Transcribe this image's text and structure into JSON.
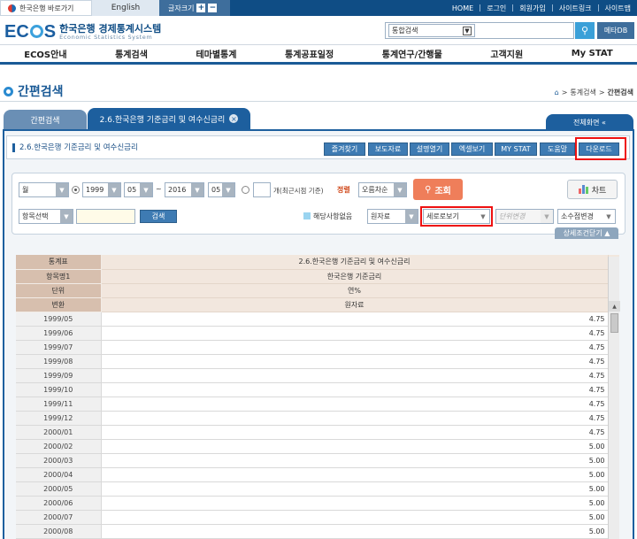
{
  "topbar": {
    "home_link": "한국은행 바로가기",
    "english": "English",
    "font_size": "글자크기",
    "font_plus": "+",
    "font_minus": "−",
    "links": [
      "HOME",
      "로그인",
      "회원가입",
      "사이트링크",
      "사이트맵"
    ]
  },
  "header": {
    "logo": "ECOS",
    "title": "한국은행 경제통계시스템",
    "subtitle": "Economic Statistics System",
    "search_scope": "통합검색",
    "meta_db": "메타DB"
  },
  "nav": [
    "ECOS안내",
    "통계검색",
    "테마별통계",
    "통계공표일정",
    "통계연구/간행물",
    "고객지원",
    "My STAT"
  ],
  "page": {
    "title": "간편검색",
    "breadcrumb": [
      "통계검색",
      "간편검색"
    ]
  },
  "tabs": {
    "tab1": "간편검색",
    "tab2": "2.6.한국은행 기준금리 및 여수신금리",
    "full_screen": "전체화면 «"
  },
  "toolbar": {
    "stat_name": "2.6.한국은행 기준금리 및 여수신금리",
    "buttons": [
      "즐겨찾기",
      "보도자료",
      "설명열기",
      "엑셀보기",
      "MY STAT",
      "도움말",
      "다운로드"
    ]
  },
  "options": {
    "period": "월",
    "start_year": "1999",
    "start_month": "05",
    "tilde": "~",
    "end_year": "2016",
    "end_month": "05",
    "recent_label": "개(최근시점 기준)",
    "sort_label": "정렬",
    "sort_value": "오름차순",
    "search_btn": "조회",
    "chart_btn": "차트",
    "item_select": "항목선택",
    "item_search_btn": "검색",
    "not_applicable": "해당사항없음",
    "raw": "원자료",
    "vertical_view": "세로로보기",
    "unit_change": "단위변경",
    "decimal_change": "소수점변경",
    "detail_toggle": "상세조건닫기 ▲"
  },
  "table": {
    "header": [
      {
        "label": "통계표",
        "value": "2.6.한국은행 기준금리 및 여수신금리"
      },
      {
        "label": "항목명1",
        "value": "한국은행 기준금리"
      },
      {
        "label": "단위",
        "value": "연%"
      },
      {
        "label": "변환",
        "value": "원자료"
      }
    ],
    "rows": [
      {
        "date": "1999/05",
        "value": "4.75"
      },
      {
        "date": "1999/06",
        "value": "4.75"
      },
      {
        "date": "1999/07",
        "value": "4.75"
      },
      {
        "date": "1999/08",
        "value": "4.75"
      },
      {
        "date": "1999/09",
        "value": "4.75"
      },
      {
        "date": "1999/10",
        "value": "4.75"
      },
      {
        "date": "1999/11",
        "value": "4.75"
      },
      {
        "date": "1999/12",
        "value": "4.75"
      },
      {
        "date": "2000/01",
        "value": "4.75"
      },
      {
        "date": "2000/02",
        "value": "5.00"
      },
      {
        "date": "2000/03",
        "value": "5.00"
      },
      {
        "date": "2000/04",
        "value": "5.00"
      },
      {
        "date": "2000/05",
        "value": "5.00"
      },
      {
        "date": "2000/06",
        "value": "5.00"
      },
      {
        "date": "2000/07",
        "value": "5.00"
      },
      {
        "date": "2000/08",
        "value": "5.00"
      }
    ]
  },
  "colors": {
    "brand_blue": "#1d5f9e",
    "highlight_red": "#e11111",
    "search_orange": "#ef7e5a"
  }
}
